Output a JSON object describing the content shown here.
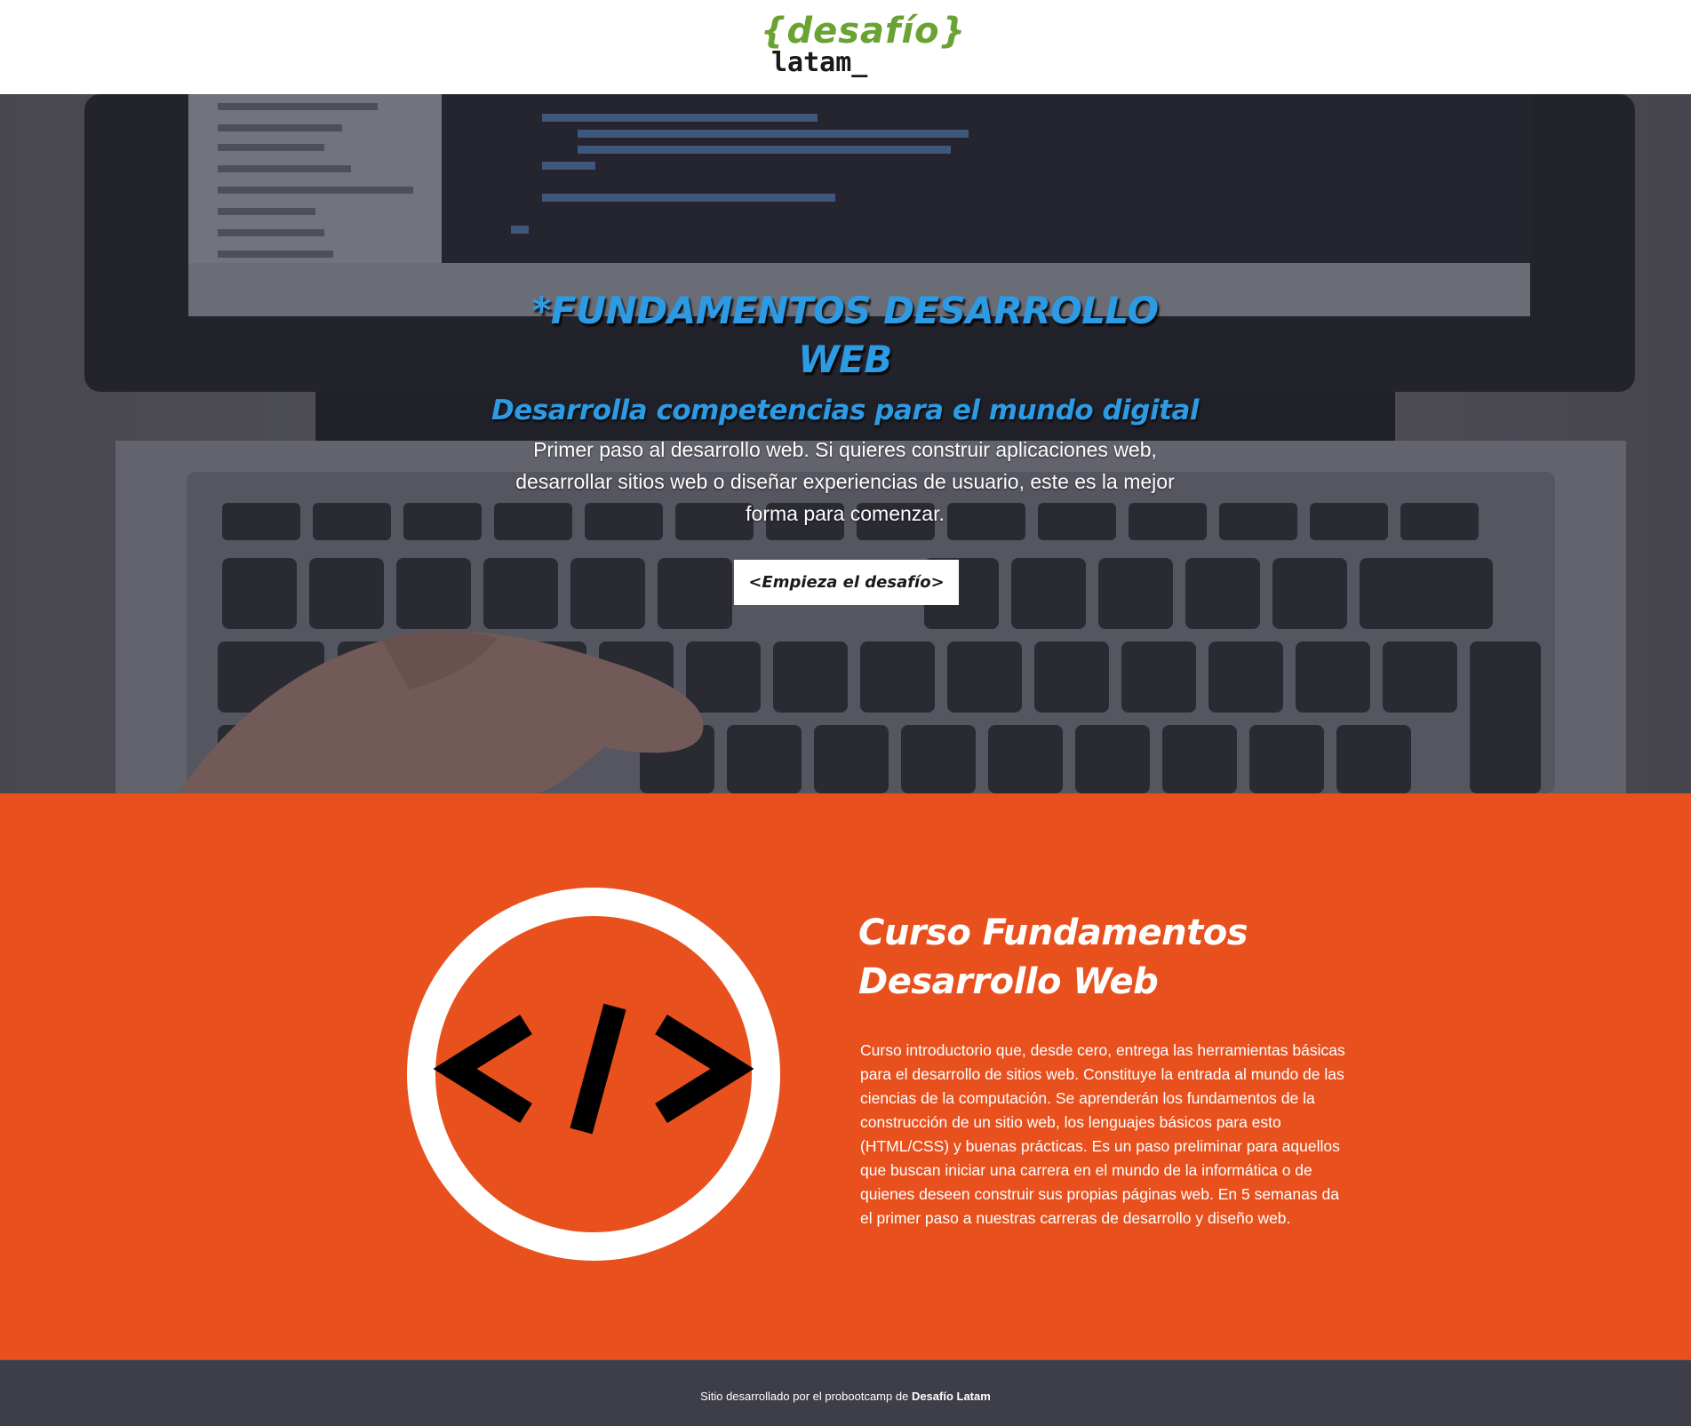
{
  "header": {
    "logo": {
      "top": "{desafío}",
      "bottom": "latam_"
    }
  },
  "hero": {
    "title": "*FUNDAMENTOS DESARROLLO WEB",
    "subtitle": "Desarrolla competencias para el mundo digital",
    "text": "Primer paso al desarrollo web. Si quieres construir aplicaciones web, desarrollar sitios web o diseñar experiencias de usuario, este es la mejor forma para comenzar.",
    "button_label": "<Empieza el desafío>"
  },
  "course": {
    "icon_glyph": "</>",
    "title": "Curso Fundamentos Desarrollo Web",
    "description": "Curso introductorio que, desde cero, entrega las herramientas básicas para el desarrollo de sitios web. Constituye la entrada al mundo de las ciencias de la computación. Se aprenderán los fundamentos de la construcción de un sitio web, los lenguajes básicos para esto (HTML/CSS) y buenas prácticas. Es un paso preliminar para aquellos que buscan iniciar una carrera en el mundo de la informática o de quienes deseen construir sus propias páginas web. En 5 semanas da el primer paso a nuestras carreras de desarrollo y diseño web."
  },
  "footer": {
    "text": "Sitio desarrollado por el probootcamp de",
    "brand": "Desafío Latam"
  },
  "colors": {
    "logo_green": "#6aa233",
    "hero_blue": "#2d9be3",
    "course_orange": "#e8511d",
    "footer_bg": "#3e3e48"
  }
}
